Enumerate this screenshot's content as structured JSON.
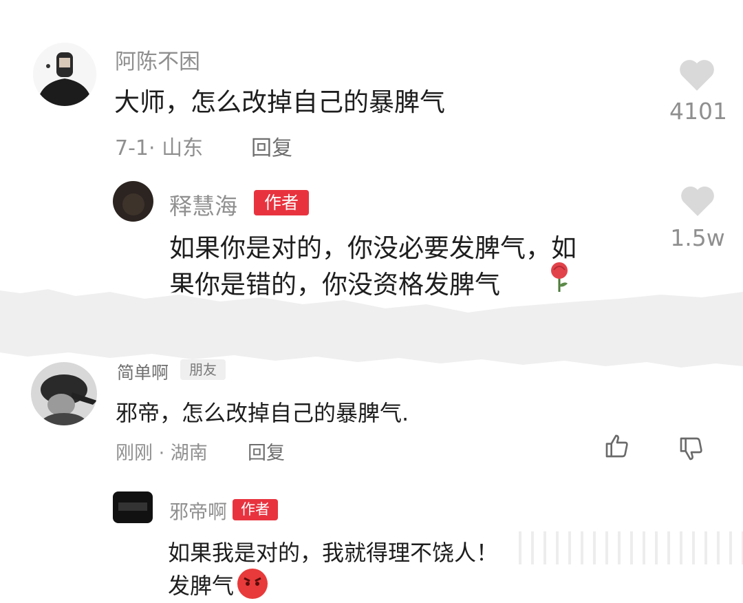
{
  "comments": [
    {
      "username": "阿陈不困",
      "text": "大师，怎么改掉自己的暴脾气",
      "date_location": "7-1· 山东",
      "reply_label": "回复",
      "like_count": "4101",
      "reply": {
        "username": "释慧海",
        "badge": "作者",
        "text_line1": "如果你是对的，你没必要发脾气，如",
        "text_line2": "果你是错的，你没资格发脾气",
        "like_count": "1.5w"
      }
    },
    {
      "username": "简单啊",
      "badge": "朋友",
      "text": "邪帝，怎么改掉自己的暴脾气.",
      "date_location": "刚刚 · 湖南",
      "reply_label": "回复",
      "reply": {
        "username": "邪帝啊",
        "badge": "作者",
        "text_line1": "如果我是对的，我就得理不饶人！",
        "text_line2": "发脾气"
      }
    }
  ],
  "colors": {
    "author_badge": "#e8333f",
    "muted_text": "#8f8f8f",
    "heart_icon": "#d9d9d9",
    "background": "#ffffff",
    "tear_band": "#f0f0f0"
  },
  "icons": [
    "heart-icon",
    "thumbs-up-icon",
    "thumbs-down-icon",
    "rose-emoji-icon",
    "angry-face-emoji-icon"
  ]
}
